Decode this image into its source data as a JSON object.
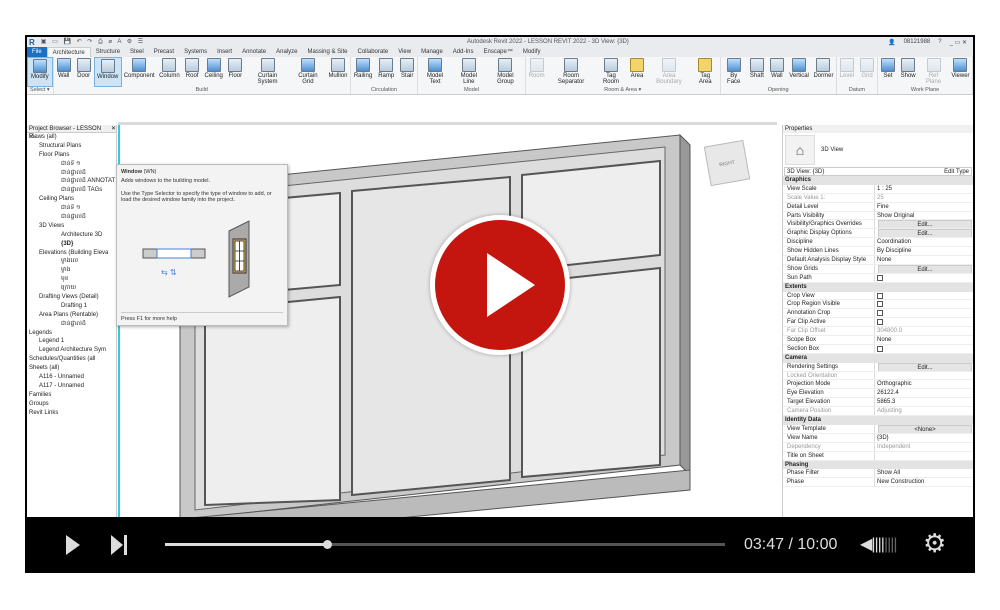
{
  "app": {
    "title": "Autodesk Revit 2022 - LESSON REVIT 2022 - 3D View: {3D}",
    "logo": "R",
    "user": "08121988",
    "help": "?"
  },
  "tabs": [
    "File",
    "Architecture",
    "Structure",
    "Steel",
    "Precast",
    "Systems",
    "Insert",
    "Annotate",
    "Analyze",
    "Massing & Site",
    "Collaborate",
    "View",
    "Manage",
    "Add-Ins",
    "Enscape™",
    "Modify"
  ],
  "ribbon": [
    {
      "panel": "Select ▾",
      "tools": [
        {
          "label": "Modify",
          "state": "sel"
        }
      ]
    },
    {
      "panel": "Build",
      "tools": [
        {
          "label": "Wall"
        },
        {
          "label": "Door"
        },
        {
          "label": "Window",
          "state": "sel"
        },
        {
          "label": "Component"
        },
        {
          "label": "Column"
        },
        {
          "label": "Roof"
        },
        {
          "label": "Ceiling"
        },
        {
          "label": "Floor"
        },
        {
          "label": "Curtain System"
        },
        {
          "label": "Curtain Grid"
        },
        {
          "label": "Mullion"
        }
      ]
    },
    {
      "panel": "Circulation",
      "tools": [
        {
          "label": "Railing"
        },
        {
          "label": "Ramp"
        },
        {
          "label": "Stair"
        }
      ]
    },
    {
      "panel": "Model",
      "tools": [
        {
          "label": "Model Text"
        },
        {
          "label": "Model Line"
        },
        {
          "label": "Model Group"
        }
      ]
    },
    {
      "panel": "Room & Area ▾",
      "tools": [
        {
          "label": "Room",
          "state": "dis"
        },
        {
          "label": "Room Separator"
        },
        {
          "label": "Tag Room"
        },
        {
          "label": "Area",
          "state": "yel"
        },
        {
          "label": "Area Boundary",
          "state": "dis"
        },
        {
          "label": "Tag Area",
          "state": "yel"
        }
      ]
    },
    {
      "panel": "Opening",
      "tools": [
        {
          "label": "By Face"
        },
        {
          "label": "Shaft"
        },
        {
          "label": "Wall"
        },
        {
          "label": "Vertical"
        },
        {
          "label": "Dormer"
        }
      ]
    },
    {
      "panel": "Datum",
      "tools": [
        {
          "label": "Level",
          "state": "dis"
        },
        {
          "label": "Grid",
          "state": "dis"
        }
      ]
    },
    {
      "panel": "Work Plane",
      "tools": [
        {
          "label": "Set"
        },
        {
          "label": "Show"
        },
        {
          "label": "Ref Plane",
          "state": "dis"
        },
        {
          "label": "Viewer"
        }
      ]
    }
  ],
  "tooltip": {
    "title": "Window",
    "shortcut": "(WN)",
    "summary": "Adds windows to the building model.",
    "detail": "Use the Type Selector to specify the type of window to add, or load the desired window family into the project.",
    "footer": "Press F1 for more help"
  },
  "project_browser": {
    "title": "Project Browser - LESSON R...",
    "items": [
      {
        "t": "Views (all)",
        "l": 0
      },
      {
        "t": "Structural Plans",
        "l": 1
      },
      {
        "t": "Floor Plans",
        "l": 1
      },
      {
        "t": "ជាន់ទី ១",
        "l": 2
      },
      {
        "t": "ជាន់ផ្ទាល់ដី",
        "l": 2
      },
      {
        "t": "ជាន់ផ្ទាល់ដី ANNOTAT",
        "l": 2
      },
      {
        "t": "ជាន់ផ្ទាល់ដី TAGs",
        "l": 2
      },
      {
        "t": "Ceiling Plans",
        "l": 1
      },
      {
        "t": "ជាន់ទី ១",
        "l": 2
      },
      {
        "t": "ជាន់ផ្ទាល់ដី",
        "l": 2
      },
      {
        "t": "3D Views",
        "l": 1
      },
      {
        "t": "Architecture 3D",
        "l": 2
      },
      {
        "t": "{3D}",
        "l": 2,
        "b": true
      },
      {
        "t": "Elevations (Building Eleva",
        "l": 1
      },
      {
        "t": "ម្ខាងលេ",
        "l": 2
      },
      {
        "t": "ម្ខាង",
        "l": 2
      },
      {
        "t": "មុខ",
        "l": 2
      },
      {
        "t": "ក្រោយ",
        "l": 2
      },
      {
        "t": "Drafting Views (Detail)",
        "l": 1
      },
      {
        "t": "Drafting 1",
        "l": 2
      },
      {
        "t": "Area Plans (Rentable)",
        "l": 1
      },
      {
        "t": "ជាន់ផ្ទាល់ដី",
        "l": 2
      },
      {
        "t": "Legends",
        "l": 0
      },
      {
        "t": "Legend 1",
        "l": 1
      },
      {
        "t": "Legend Architecture Sym",
        "l": 1
      },
      {
        "t": "Schedules/Quantities (all",
        "l": 0
      },
      {
        "t": "Sheets (all)",
        "l": 0
      },
      {
        "t": "A116 - Unnamed",
        "l": 1
      },
      {
        "t": "A117 - Unnamed",
        "l": 1
      },
      {
        "t": "Families",
        "l": 0
      },
      {
        "t": "Groups",
        "l": 0
      },
      {
        "t": "Revit Links",
        "l": 0
      }
    ]
  },
  "properties": {
    "title": "Properties",
    "type": "3D View",
    "selector": "3D View: {3D}",
    "edit_type": "Edit Type",
    "sections": [
      {
        "name": "Graphics",
        "rows": [
          [
            "View Scale",
            "1 : 25"
          ],
          [
            "Scale Value 1:",
            "25",
            "dis"
          ],
          [
            "Detail Level",
            "Fine"
          ],
          [
            "Parts Visibility",
            "Show Original"
          ],
          [
            "Visibility/Graphics Overrides",
            "Edit...",
            "btn"
          ],
          [
            "Graphic Display Options",
            "Edit...",
            "btn"
          ],
          [
            "Discipline",
            "Coordination"
          ],
          [
            "Show Hidden Lines",
            "By Discipline"
          ],
          [
            "Default Analysis Display Style",
            "None"
          ],
          [
            "Show Grids",
            "Edit...",
            "btn"
          ],
          [
            "Sun Path",
            "",
            "cb"
          ]
        ]
      },
      {
        "name": "Extents",
        "rows": [
          [
            "Crop View",
            "",
            "cb"
          ],
          [
            "Crop Region Visible",
            "",
            "cb"
          ],
          [
            "Annotation Crop",
            "",
            "cb"
          ],
          [
            "Far Clip Active",
            "",
            "cb"
          ],
          [
            "Far Clip Offset",
            "304800.0",
            "dis"
          ],
          [
            "Scope Box",
            "None"
          ],
          [
            "Section Box",
            "",
            "cb"
          ]
        ]
      },
      {
        "name": "Camera",
        "rows": [
          [
            "Rendering Settings",
            "Edit...",
            "btn"
          ],
          [
            "Locked Orientation",
            "",
            "dis"
          ],
          [
            "Projection Mode",
            "Orthographic"
          ],
          [
            "Eye Elevation",
            "26122.4"
          ],
          [
            "Target Elevation",
            "5865.3"
          ],
          [
            "Camera Position",
            "Adjusting",
            "dis"
          ]
        ]
      },
      {
        "name": "Identity Data",
        "rows": [
          [
            "View Template",
            "<None>",
            "btn"
          ],
          [
            "View Name",
            "{3D}"
          ],
          [
            "Dependency",
            "Independent",
            "dis"
          ],
          [
            "Title on Sheet",
            ""
          ]
        ]
      },
      {
        "name": "Phasing",
        "rows": [
          [
            "Phase Filter",
            "Show All"
          ],
          [
            "Phase",
            "New Construction"
          ]
        ]
      }
    ]
  },
  "viewcube": {
    "face": "RIGHT"
  },
  "player": {
    "time": "03:47 / 10:00",
    "progress": 0.29,
    "volume": 0.5,
    "accent": "#c4150f"
  }
}
